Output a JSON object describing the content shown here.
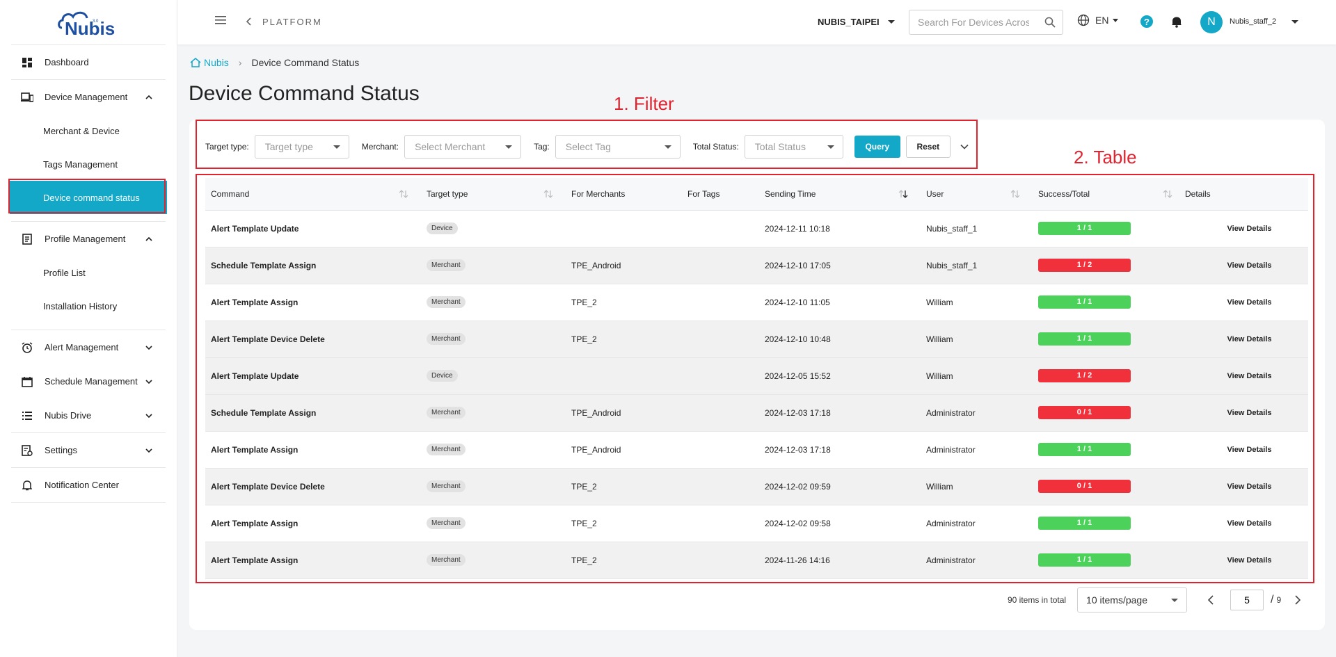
{
  "brand": {
    "logo_text": "Nubis",
    "logo_badge": "3.0",
    "accent": "#13a8c8"
  },
  "sidebar": {
    "dashboard": "Dashboard",
    "device_mgmt": "Device Management",
    "device_sub": [
      "Merchant & Device",
      "Tags Management",
      "Device command status"
    ],
    "profile_mgmt": "Profile Management",
    "profile_sub": [
      "Profile List",
      "Installation History"
    ],
    "alert_mgmt": "Alert Management",
    "schedule_mgmt": "Schedule Management",
    "drive": "Nubis Drive",
    "settings": "Settings",
    "notification": "Notification Center"
  },
  "topbar": {
    "section": "PLATFORM",
    "org": "NUBIS_TAIPEI",
    "search_placeholder": "Search For Devices Across",
    "lang": "EN",
    "help": "?",
    "avatar_initial": "N",
    "user": "Nubis_staff_2"
  },
  "breadcrumb": {
    "home": "Nubis",
    "current": "Device Command Status"
  },
  "page_title": "Device Command Status",
  "annotations": {
    "filter": "1. Filter",
    "table": "2. Table",
    "color": "#e0232f"
  },
  "filters": {
    "target_type_label": "Target type:",
    "target_type_placeholder": "Target type",
    "merchant_label": "Merchant:",
    "merchant_placeholder": "Select Merchant",
    "tag_label": "Tag:",
    "tag_placeholder": "Select Tag",
    "status_label": "Total Status:",
    "status_placeholder": "Total Status",
    "query": "Query",
    "reset": "Reset"
  },
  "table": {
    "headers": [
      "Command",
      "Target type",
      "For Merchants",
      "For Tags",
      "Sending Time",
      "User",
      "Success/Total",
      "Details"
    ],
    "rows": [
      {
        "command": "Alert Template Update",
        "target": "Device",
        "merchant": "",
        "tags": "",
        "time": "2024-12-11 10:18",
        "user": "Nubis_staff_1",
        "ratio": "1 / 1",
        "status": "ok",
        "details": "View Details"
      },
      {
        "command": "Schedule Template Assign",
        "target": "Merchant",
        "merchant": "TPE_Android",
        "tags": "",
        "time": "2024-12-10 17:05",
        "user": "Nubis_staff_1",
        "ratio": "1 / 2",
        "status": "bad",
        "details": "View Details"
      },
      {
        "command": "Alert Template Assign",
        "target": "Merchant",
        "merchant": "TPE_2",
        "tags": "",
        "time": "2024-12-10 11:05",
        "user": "William",
        "ratio": "1 / 1",
        "status": "ok",
        "details": "View Details"
      },
      {
        "command": "Alert Template Device Delete",
        "target": "Merchant",
        "merchant": "TPE_2",
        "tags": "",
        "time": "2024-12-10 10:48",
        "user": "William",
        "ratio": "1 / 1",
        "status": "ok",
        "details": "View Details"
      },
      {
        "command": "Alert Template Update",
        "target": "Device",
        "merchant": "",
        "tags": "",
        "time": "2024-12-05 15:52",
        "user": "William",
        "ratio": "1 / 2",
        "status": "bad",
        "details": "View Details"
      },
      {
        "command": "Schedule Template Assign",
        "target": "Merchant",
        "merchant": "TPE_Android",
        "tags": "",
        "time": "2024-12-03 17:18",
        "user": "Administrator",
        "ratio": "0 / 1",
        "status": "bad",
        "details": "View Details"
      },
      {
        "command": "Alert Template Assign",
        "target": "Merchant",
        "merchant": "TPE_Android",
        "tags": "",
        "time": "2024-12-03 17:18",
        "user": "Administrator",
        "ratio": "1 / 1",
        "status": "ok",
        "details": "View Details"
      },
      {
        "command": "Alert Template Device Delete",
        "target": "Merchant",
        "merchant": "TPE_2",
        "tags": "",
        "time": "2024-12-02 09:59",
        "user": "William",
        "ratio": "0 / 1",
        "status": "bad",
        "details": "View Details"
      },
      {
        "command": "Alert Template Assign",
        "target": "Merchant",
        "merchant": "TPE_2",
        "tags": "",
        "time": "2024-12-02 09:58",
        "user": "Administrator",
        "ratio": "1 / 1",
        "status": "ok",
        "details": "View Details"
      },
      {
        "command": "Alert Template Assign",
        "target": "Merchant",
        "merchant": "TPE_2",
        "tags": "",
        "time": "2024-11-26 14:16",
        "user": "Administrator",
        "ratio": "1 / 1",
        "status": "ok",
        "details": "View Details"
      }
    ]
  },
  "pagination": {
    "total": "90 items in total",
    "page_size": "10 items/page",
    "current_page": "5",
    "total_pages": "9"
  },
  "colors": {
    "success": "#4cd15a",
    "failure": "#f0313b"
  }
}
